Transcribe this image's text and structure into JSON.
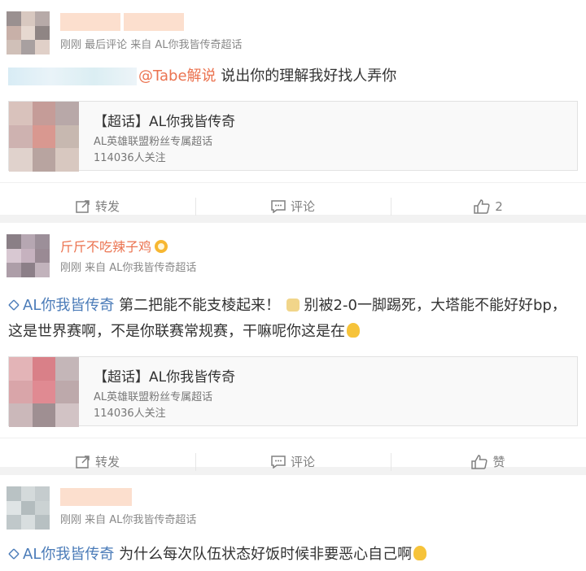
{
  "posts": [
    {
      "meta": "刚刚  最后评论  来自 AL你我皆传奇超话",
      "mention": "@Tabe解说",
      "text": " 说出你的理解我好找人弄你",
      "card": {
        "title": "【超话】AL你我皆传奇",
        "sub": "AL英雄联盟粉丝专属超话",
        "count": "114036人关注"
      },
      "actions": {
        "repost": "转发",
        "comment": "评论",
        "like": "2"
      }
    },
    {
      "author": "斤斤不吃辣子鸡",
      "meta": "刚刚  来自 AL你我皆传奇超话",
      "topic": "AL你我皆传奇",
      "text1": " 第二把能不能支棱起来！",
      "text2": "别被2-0一脚踢死，大塔能不能好好bp，这是世界赛啊，不是你联赛常规赛，干嘛呢你这是在",
      "card": {
        "title": "【超话】AL你我皆传奇",
        "sub": "AL英雄联盟粉丝专属超话",
        "count": "114036人关注"
      },
      "actions": {
        "repost": "转发",
        "comment": "评论",
        "like": "赞"
      }
    },
    {
      "meta": "刚刚  来自 AL你我皆传奇超话",
      "topic": "AL你我皆传奇",
      "text": " 为什么每次队伍状态好饭时候非要恶心自己啊"
    }
  ],
  "colors": {
    "accent_orange": "#eb7350",
    "topic_blue": "#4a7bb8",
    "name_orange": "#eb7350"
  }
}
